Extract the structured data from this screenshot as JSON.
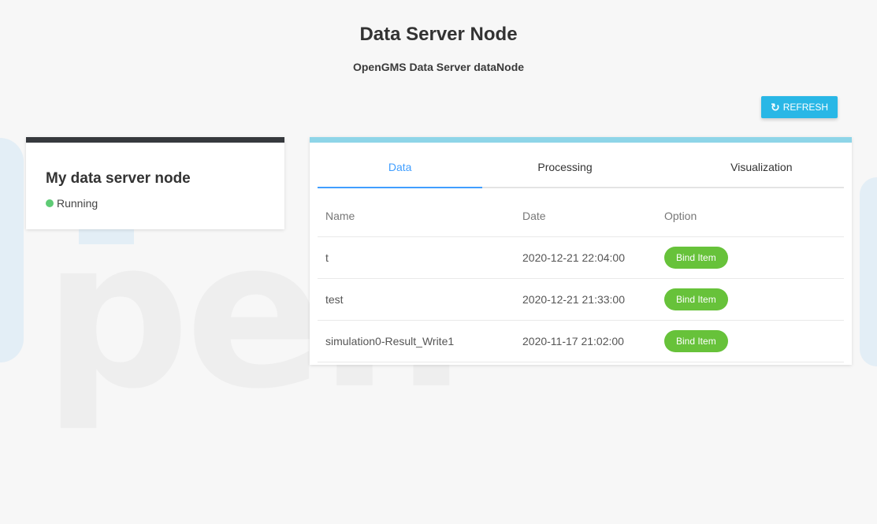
{
  "header": {
    "title": "Data Server Node",
    "subtitle": "OpenGMS Data Server dataNode"
  },
  "toolbar": {
    "refresh_label": "REFRESH",
    "refresh_icon": "refresh-icon",
    "refresh_color": "#29b7e6"
  },
  "node": {
    "name": "My data server node",
    "status": "Running",
    "status_color": "#5ecb75"
  },
  "tabs": [
    {
      "label": "Data",
      "active": true
    },
    {
      "label": "Processing",
      "active": false
    },
    {
      "label": "Visualization",
      "active": false
    }
  ],
  "table": {
    "columns": [
      "Name",
      "Date",
      "Option"
    ],
    "rows": [
      {
        "name": "t",
        "date": "2020-12-21 22:04:00",
        "option": "Bind Item"
      },
      {
        "name": "test",
        "date": "2020-12-21 21:33:00",
        "option": "Bind Item"
      },
      {
        "name": "simulation0-Result_Write1",
        "date": "2020-11-17 21:02:00",
        "option": "Bind Item"
      }
    ]
  },
  "watermark": {
    "text": "pen"
  },
  "colors": {
    "accent": "#409eff",
    "bind_button": "#67c23a",
    "card_top_dark": "#36393d",
    "card_top_light": "#8ed5e8"
  }
}
